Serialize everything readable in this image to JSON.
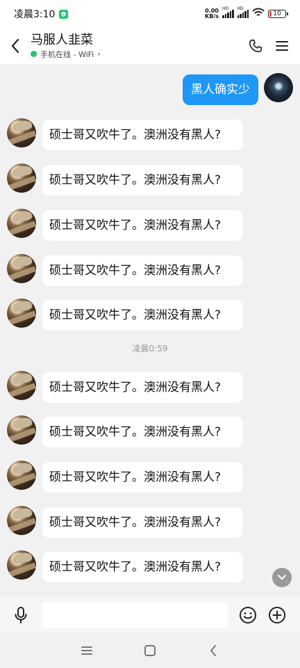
{
  "status_bar": {
    "time": "凌晨3:10",
    "net_speed_value": "0.00",
    "net_speed_unit": "KB/s",
    "signal_label_1": "HD",
    "signal_label_2": "HD",
    "battery": "10"
  },
  "header": {
    "title": "马服人韭菜",
    "presence": "手机在线 - WiFi",
    "presence_chevron": "›",
    "icons": [
      "back-arrow-icon",
      "phone-icon",
      "menu-icon"
    ]
  },
  "messages": {
    "outgoing": {
      "text": "黑人确实少"
    },
    "incoming_group_1": [
      {
        "text": "硕士哥又吹牛了。澳洲没有黑人?"
      },
      {
        "text": "硕士哥又吹牛了。澳洲没有黑人?"
      },
      {
        "text": "硕士哥又吹牛了。澳洲没有黑人?"
      },
      {
        "text": "硕士哥又吹牛了。澳洲没有黑人?"
      },
      {
        "text": "硕士哥又吹牛了。澳洲没有黑人?"
      }
    ],
    "timestamp": "凌晨0:59",
    "incoming_group_2": [
      {
        "text": "硕士哥又吹牛了。澳洲没有黑人?"
      },
      {
        "text": "硕士哥又吹牛了。澳洲没有黑人?"
      },
      {
        "text": "硕士哥又吹牛了。澳洲没有黑人?"
      },
      {
        "text": "硕士哥又吹牛了。澳洲没有黑人?"
      },
      {
        "text": "硕士哥又吹牛了。澳洲没有黑人?"
      }
    ]
  },
  "input_bar": {
    "value": "",
    "placeholder": "",
    "icons": [
      "microphone-icon",
      "emoji-icon",
      "plus-icon"
    ]
  },
  "nav_bar": {
    "icons": [
      "nav-menu-icon",
      "nav-home-icon",
      "nav-back-icon"
    ]
  },
  "colors": {
    "accent_blue": "#1e97f5",
    "presence_green": "#27c46b",
    "background": "#f1f1f1",
    "bubble_white": "#ffffff"
  }
}
